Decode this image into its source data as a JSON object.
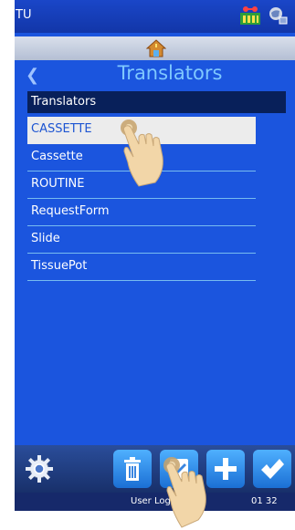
{
  "status_bar": {
    "label": "TU"
  },
  "header": {
    "title": "Translators",
    "back_icon": "chevron-left-icon",
    "home_icon": "house-icon"
  },
  "list": {
    "header": "Translators",
    "items": [
      "CASSETTE",
      "Cassette",
      "ROUTINE",
      "RequestForm",
      "Slide",
      "TissuePot"
    ],
    "selected_index": 0
  },
  "toolbar": {
    "buttons": [
      "gear-icon",
      "trash-icon",
      "edit-icon",
      "plus-icon",
      "check-icon"
    ]
  },
  "footer": {
    "user": "User Log",
    "time": "01 32"
  },
  "colors": {
    "background": "#1b55de",
    "list_header": "#08205a",
    "title": "#7fc8ff",
    "selection": "#ececec"
  }
}
